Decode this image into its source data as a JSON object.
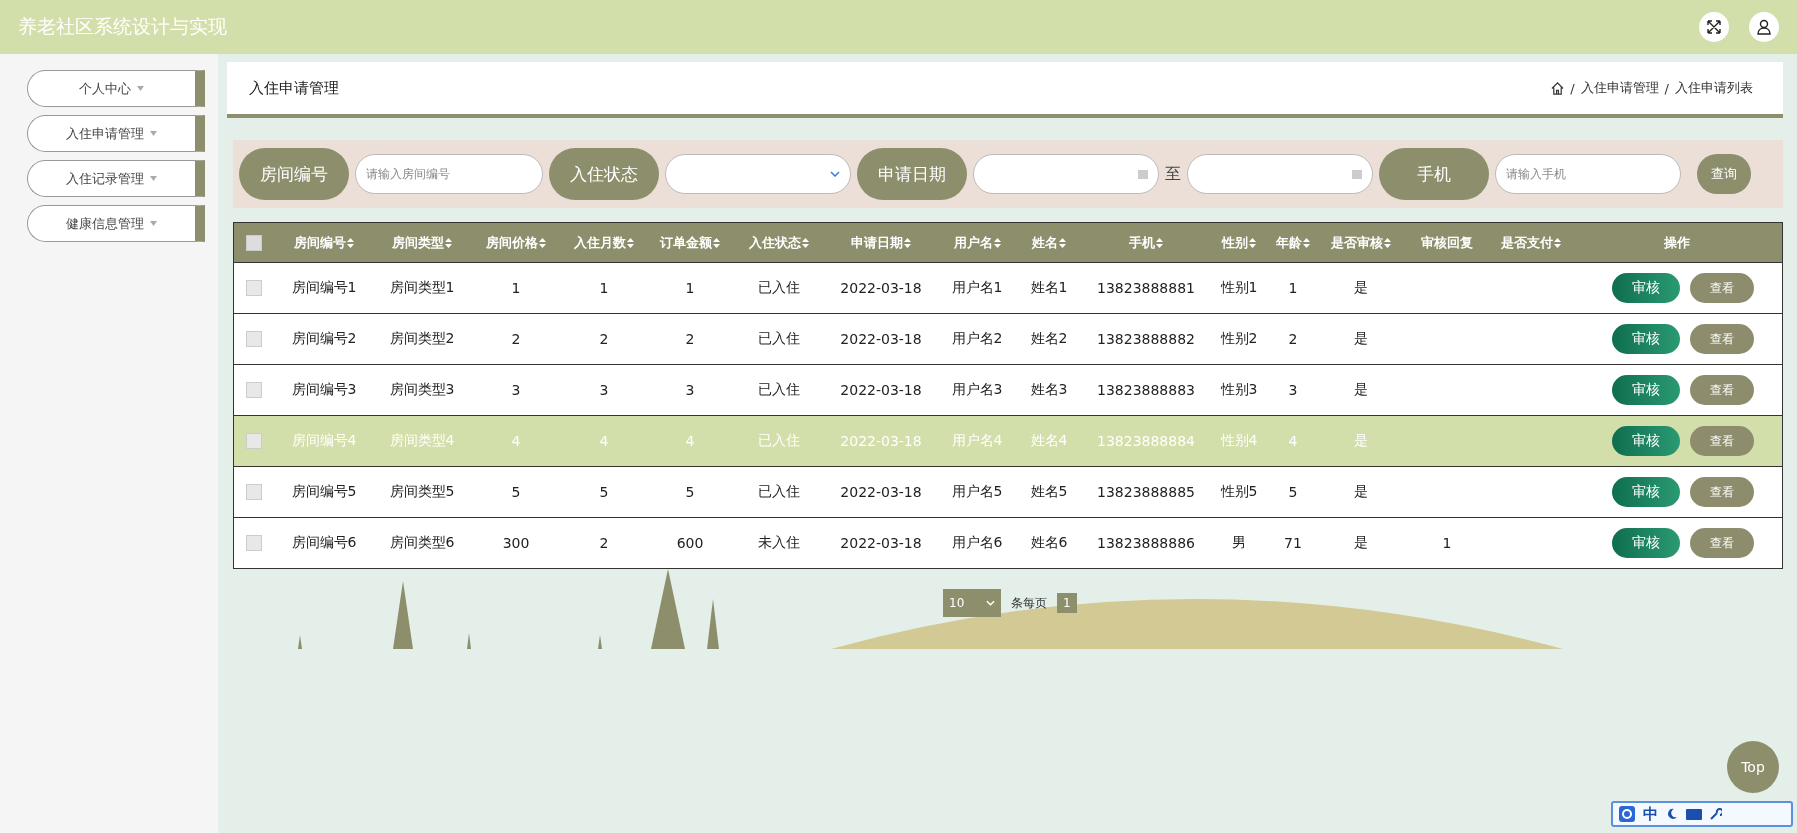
{
  "header": {
    "title": "养老社区系统设计与实现"
  },
  "sidebar": {
    "items": [
      {
        "label": "个人中心"
      },
      {
        "label": "入住申请管理"
      },
      {
        "label": "入住记录管理"
      },
      {
        "label": "健康信息管理"
      }
    ]
  },
  "page_title": "入住申请管理",
  "breadcrumb": {
    "separator": "/",
    "items": [
      "入住申请管理",
      "入住申请列表"
    ]
  },
  "search": {
    "fields": [
      {
        "kind": "text",
        "label": "房间编号",
        "placeholder": "请输入房间编号"
      },
      {
        "kind": "select",
        "label": "入住状态"
      },
      {
        "kind": "daterange",
        "label": "申请日期",
        "separator": "至"
      },
      {
        "kind": "text",
        "label": "手机",
        "placeholder": "请输入手机"
      }
    ],
    "button": "查询"
  },
  "table": {
    "select_all_checked": false,
    "columns": [
      {
        "label": "房间编号",
        "sortable": true
      },
      {
        "label": "房间类型",
        "sortable": true
      },
      {
        "label": "房间价格",
        "sortable": true
      },
      {
        "label": "入住月数",
        "sortable": true
      },
      {
        "label": "订单金额",
        "sortable": true
      },
      {
        "label": "入住状态",
        "sortable": true
      },
      {
        "label": "申请日期",
        "sortable": true
      },
      {
        "label": "用户名",
        "sortable": true
      },
      {
        "label": "姓名",
        "sortable": true
      },
      {
        "label": "手机",
        "sortable": true
      },
      {
        "label": "性别",
        "sortable": true
      },
      {
        "label": "年龄",
        "sortable": true
      },
      {
        "label": "是否审核",
        "sortable": true
      },
      {
        "label": "审核回复",
        "sortable": false
      },
      {
        "label": "是否支付",
        "sortable": true
      },
      {
        "label": "操作",
        "sortable": false
      }
    ],
    "rows": [
      {
        "checked": false,
        "hovered": false,
        "cells": [
          "房间编号1",
          "房间类型1",
          "1",
          "1",
          "1",
          "已入住",
          "2022-03-18",
          "用户名1",
          "姓名1",
          "13823888881",
          "性别1",
          "1",
          "是",
          "",
          ""
        ],
        "actions": [
          "审核",
          "查看"
        ]
      },
      {
        "checked": false,
        "hovered": false,
        "cells": [
          "房间编号2",
          "房间类型2",
          "2",
          "2",
          "2",
          "已入住",
          "2022-03-18",
          "用户名2",
          "姓名2",
          "13823888882",
          "性别2",
          "2",
          "是",
          "",
          ""
        ],
        "actions": [
          "审核",
          "查看"
        ]
      },
      {
        "checked": false,
        "hovered": false,
        "cells": [
          "房间编号3",
          "房间类型3",
          "3",
          "3",
          "3",
          "已入住",
          "2022-03-18",
          "用户名3",
          "姓名3",
          "13823888883",
          "性别3",
          "3",
          "是",
          "",
          ""
        ],
        "actions": [
          "审核",
          "查看"
        ]
      },
      {
        "checked": false,
        "hovered": true,
        "cells": [
          "房间编号4",
          "房间类型4",
          "4",
          "4",
          "4",
          "已入住",
          "2022-03-18",
          "用户名4",
          "姓名4",
          "13823888884",
          "性别4",
          "4",
          "是",
          "",
          ""
        ],
        "actions": [
          "审核",
          "查看"
        ]
      },
      {
        "checked": false,
        "hovered": false,
        "cells": [
          "房间编号5",
          "房间类型5",
          "5",
          "5",
          "5",
          "已入住",
          "2022-03-18",
          "用户名5",
          "姓名5",
          "13823888885",
          "性别5",
          "5",
          "是",
          "",
          ""
        ],
        "actions": [
          "审核",
          "查看"
        ]
      },
      {
        "checked": false,
        "hovered": false,
        "cells": [
          "房间编号6",
          "房间类型6",
          "300",
          "2",
          "600",
          "未入住",
          "2022-03-18",
          "用户名6",
          "姓名6",
          "13823888886",
          "男",
          "71",
          "是",
          "1",
          ""
        ],
        "actions": [
          "审核",
          "查看"
        ]
      }
    ]
  },
  "pagination": {
    "page_size": "10",
    "page_size_label": "条每页",
    "pages": [
      {
        "label": "1",
        "selected": true
      }
    ]
  },
  "back_to_top": "Top",
  "ime_toolbar": {
    "mode": "中"
  }
}
